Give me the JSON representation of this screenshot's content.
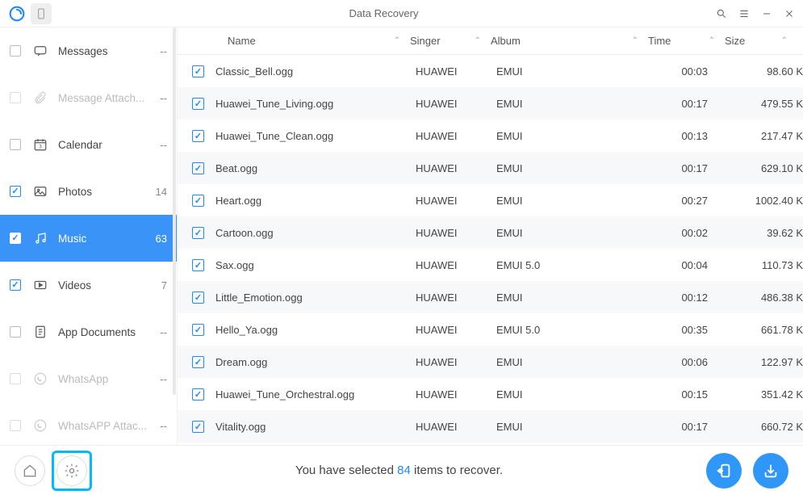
{
  "title": "Data Recovery",
  "sidebar": [
    {
      "id": "messages",
      "label": "Messages",
      "count": "--",
      "checked": false,
      "active": false,
      "disabled": false,
      "icon": "chat"
    },
    {
      "id": "msg-attach",
      "label": "Message Attach...",
      "count": "--",
      "checked": false,
      "active": false,
      "disabled": true,
      "icon": "attach"
    },
    {
      "id": "calendar",
      "label": "Calendar",
      "count": "--",
      "checked": false,
      "active": false,
      "disabled": false,
      "icon": "calendar"
    },
    {
      "id": "photos",
      "label": "Photos",
      "count": "14",
      "checked": true,
      "active": false,
      "disabled": false,
      "icon": "photo"
    },
    {
      "id": "music",
      "label": "Music",
      "count": "63",
      "checked": true,
      "active": true,
      "disabled": false,
      "icon": "music"
    },
    {
      "id": "videos",
      "label": "Videos",
      "count": "7",
      "checked": true,
      "active": false,
      "disabled": false,
      "icon": "video"
    },
    {
      "id": "appdocs",
      "label": "App Documents",
      "count": "--",
      "checked": false,
      "active": false,
      "disabled": false,
      "icon": "doc"
    },
    {
      "id": "whatsapp",
      "label": "WhatsApp",
      "count": "--",
      "checked": false,
      "active": false,
      "disabled": true,
      "icon": "whatsapp"
    },
    {
      "id": "whatsapp-attach",
      "label": "WhatsAPP Attac...",
      "count": "--",
      "checked": false,
      "active": false,
      "disabled": true,
      "icon": "whatsapp"
    }
  ],
  "columns": {
    "name": "Name",
    "singer": "Singer",
    "album": "Album",
    "time": "Time",
    "size": "Size"
  },
  "rows": [
    {
      "name": "Classic_Bell.ogg",
      "singer": "HUAWEI",
      "album": "EMUI",
      "time": "00:03",
      "size": "98.60 K"
    },
    {
      "name": "Huawei_Tune_Living.ogg",
      "singer": "HUAWEI",
      "album": "EMUI",
      "time": "00:17",
      "size": "479.55 K"
    },
    {
      "name": "Huawei_Tune_Clean.ogg",
      "singer": "HUAWEI",
      "album": "EMUI",
      "time": "00:13",
      "size": "217.47 K"
    },
    {
      "name": "Beat.ogg",
      "singer": "HUAWEI",
      "album": "EMUI",
      "time": "00:17",
      "size": "629.10 K"
    },
    {
      "name": "Heart.ogg",
      "singer": "HUAWEI",
      "album": "EMUI",
      "time": "00:27",
      "size": "1002.40 K"
    },
    {
      "name": "Cartoon.ogg",
      "singer": "HUAWEI",
      "album": "EMUI",
      "time": "00:02",
      "size": "39.62 K"
    },
    {
      "name": "Sax.ogg",
      "singer": "HUAWEI",
      "album": "EMUI 5.0",
      "time": "00:04",
      "size": "110.73 K"
    },
    {
      "name": "Little_Emotion.ogg",
      "singer": "HUAWEI",
      "album": "EMUI",
      "time": "00:12",
      "size": "486.38 K"
    },
    {
      "name": "Hello_Ya.ogg",
      "singer": "HUAWEI",
      "album": "EMUI 5.0",
      "time": "00:35",
      "size": "661.78 K"
    },
    {
      "name": "Dream.ogg",
      "singer": "HUAWEI",
      "album": "EMUI",
      "time": "00:06",
      "size": "122.97 K"
    },
    {
      "name": "Huawei_Tune_Orchestral.ogg",
      "singer": "HUAWEI",
      "album": "EMUI",
      "time": "00:15",
      "size": "351.42 K"
    },
    {
      "name": "Vitality.ogg",
      "singer": "HUAWEI",
      "album": "EMUI",
      "time": "00:17",
      "size": "660.72 K"
    }
  ],
  "footer": {
    "prefix": "You have selected ",
    "count": "84",
    "suffix": " items to recover."
  }
}
